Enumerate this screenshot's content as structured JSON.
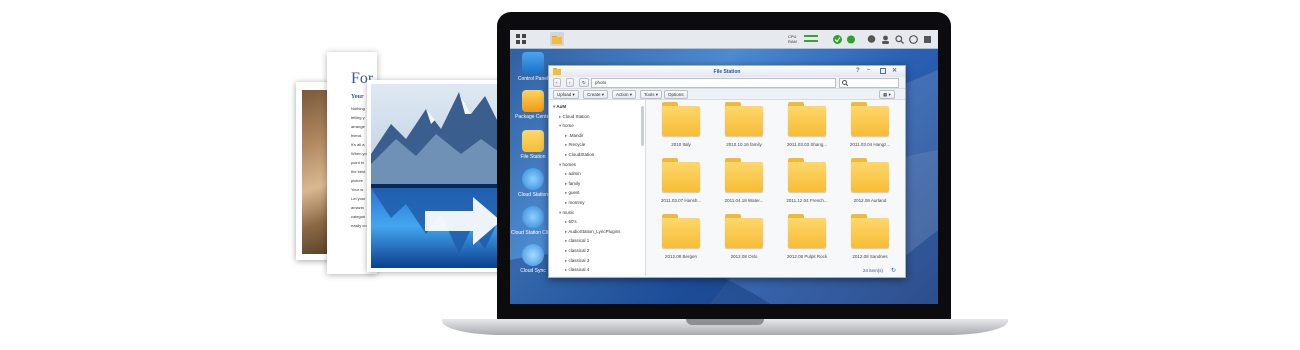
{
  "doc": {
    "title": "For",
    "heading": "Your",
    "lines": [
      "Nothing",
      "telling y",
      "arrange",
      "friend.",
      "It's all a",
      "When yo",
      "point in",
      "the best",
      "picture",
      "Your w",
      "Let your",
      "amazin",
      "categori",
      "easily co"
    ]
  },
  "taskbar": {
    "cpu_label": "CPU",
    "ram_label": "RAM"
  },
  "desktop": {
    "icons": [
      {
        "label": "Control Panel",
        "icon": "control-panel-icon"
      },
      {
        "label": "Package Center",
        "icon": "package-center-icon"
      },
      {
        "label": "File Station",
        "icon": "file-station-icon"
      },
      {
        "label": "Cloud Station",
        "icon": "cloud-station-icon"
      },
      {
        "label": "Cloud Station Client",
        "icon": "cloud-client-icon"
      },
      {
        "label": "Cloud Sync",
        "icon": "cloud-sync-icon"
      }
    ]
  },
  "window": {
    "title": "File Station",
    "path": "photo",
    "buttons": [
      "Upload",
      "Create",
      "Action",
      "Tools",
      "Options"
    ],
    "tree": [
      {
        "label": "AuM",
        "depth": 0,
        "bold": true
      },
      {
        "label": "Cloud Station",
        "depth": 1
      },
      {
        "label": "home",
        "depth": 1
      },
      {
        "label": ".Mandir",
        "depth": 2
      },
      {
        "label": "#recycle",
        "depth": 2
      },
      {
        "label": "CloudStation",
        "depth": 2
      },
      {
        "label": "homes",
        "depth": 1
      },
      {
        "label": "admin",
        "depth": 2
      },
      {
        "label": "family",
        "depth": 2
      },
      {
        "label": "guest",
        "depth": 2
      },
      {
        "label": "mommy",
        "depth": 2
      },
      {
        "label": "music",
        "depth": 1
      },
      {
        "label": "60's",
        "depth": 2
      },
      {
        "label": "AudioStation_LyricPlugins",
        "depth": 2
      },
      {
        "label": "classical 1",
        "depth": 2
      },
      {
        "label": "classical 2",
        "depth": 2
      },
      {
        "label": "classical 3",
        "depth": 2
      },
      {
        "label": "classical 4",
        "depth": 2
      }
    ],
    "folders": [
      "2010 Italy",
      "2010.10.16 family",
      "2011.03.03 Shang...",
      "2011.03.04 Hangz...",
      "2011.03.07 Hansh...",
      "2011.04.18 Water...",
      "2011.12.04 French...",
      "2012.08 Aurland",
      "2012.08 Bergen",
      "2012.08 Oslo",
      "2012.08 Pulpit Rock",
      "2012.08 Sandnes"
    ],
    "status": "24 item(s)"
  },
  "colors": {
    "accent": "#215a9b",
    "folder": "#f5bd37",
    "wallpaper": "#2a61b4"
  }
}
